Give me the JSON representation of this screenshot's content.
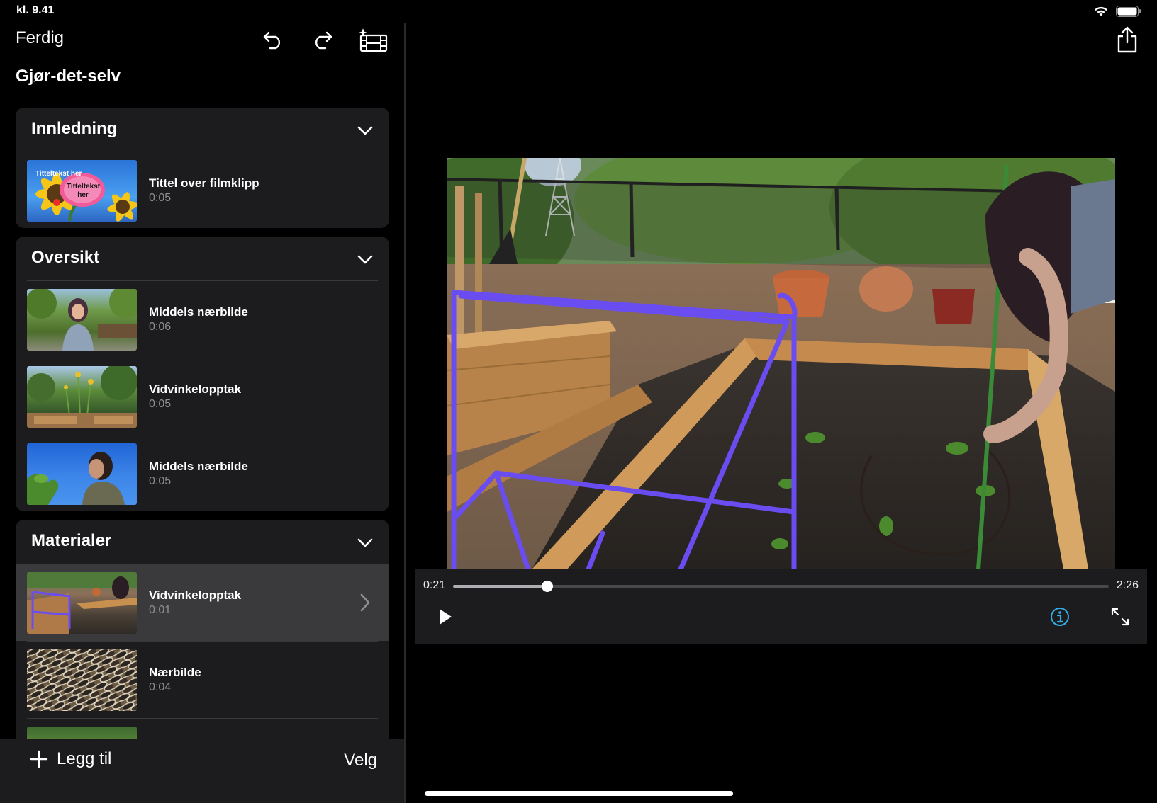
{
  "status": {
    "time": "kl. 9.41"
  },
  "toolbar": {
    "done_label": "Ferdig"
  },
  "project": {
    "title": "Gjør-det-selv"
  },
  "sections": {
    "intro": {
      "title": "Innledning",
      "clips": [
        {
          "name": "Tittel over filmklipp",
          "duration": "0:05",
          "thumb_text_1": "Titteltekst her",
          "thumb_text_2": "Titteltekst her"
        }
      ]
    },
    "overview": {
      "title": "Oversikt",
      "clips": [
        {
          "name": "Middels nærbilde",
          "duration": "0:06"
        },
        {
          "name": "Vidvinkelopptak",
          "duration": "0:05"
        },
        {
          "name": "Middels nærbilde",
          "duration": "0:05"
        }
      ]
    },
    "materials": {
      "title": "Materialer",
      "clips": [
        {
          "name": "Vidvinkelopptak",
          "duration": "0:01",
          "selected": true
        },
        {
          "name": "Nærbilde",
          "duration": "0:04"
        }
      ]
    }
  },
  "bottom_bar": {
    "add_label": "Legg til",
    "select_label": "Velg"
  },
  "player": {
    "current_time": "0:21",
    "total_time": "2:26",
    "progress": 0.144
  },
  "colors": {
    "accent": "#32ade6",
    "frame_purple": "#6a4df0"
  }
}
